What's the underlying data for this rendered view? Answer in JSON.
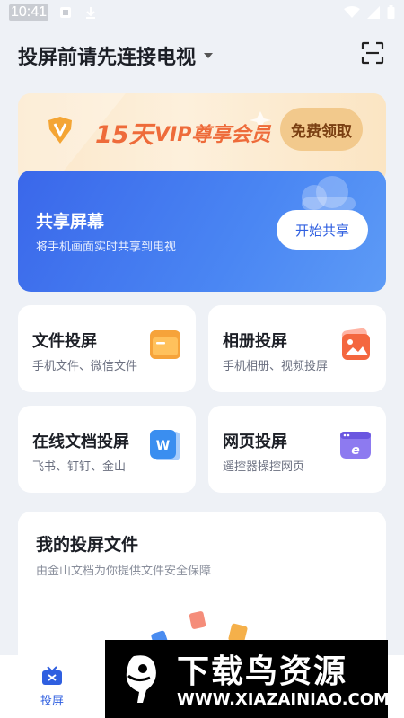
{
  "status_bar": {
    "time": "10:41"
  },
  "header": {
    "title": "投屏前请先连接电视"
  },
  "vip_banner": {
    "days": "15天",
    "text": "VIP尊享会员",
    "claim_label": "免费领取"
  },
  "share_card": {
    "title": "共享屏幕",
    "subtitle": "将手机画面实时共享到电视",
    "button_label": "开始共享"
  },
  "tiles": [
    {
      "title": "文件投屏",
      "subtitle": "手机文件、微信文件",
      "icon": "folder-icon"
    },
    {
      "title": "相册投屏",
      "subtitle": "手机相册、视频投屏",
      "icon": "photo-icon"
    },
    {
      "title": "在线文档投屏",
      "subtitle": "飞书、钉钉、金山",
      "icon": "word-doc-icon"
    },
    {
      "title": "网页投屏",
      "subtitle": "遥控器操控网页",
      "icon": "browser-icon"
    }
  ],
  "files_card": {
    "title": "我的投屏文件",
    "subtitle": "由金山文档为你提供文件安全保障"
  },
  "bottom_nav": {
    "items": [
      {
        "label": "投屏",
        "icon": "cast-icon",
        "active": true
      }
    ]
  },
  "watermark": {
    "title": "下载鸟资源",
    "url": "WWW.XIAZAINIAO.COM"
  },
  "colors": {
    "accent": "#2f5fe0",
    "vip_orange": "#ee6b3a",
    "background": "#eef1f6"
  }
}
